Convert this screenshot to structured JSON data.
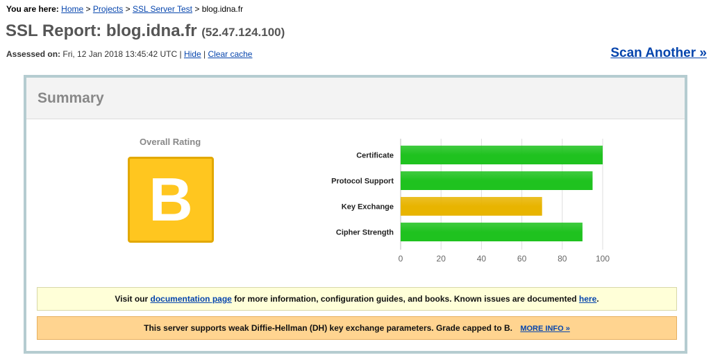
{
  "breadcrumb": {
    "prefix": "You are here:",
    "items": [
      "Home",
      "Projects",
      "SSL Server Test"
    ],
    "current": "blog.idna.fr"
  },
  "title": {
    "main": "SSL Report: blog.idna.fr",
    "ip": "(52.47.124.100)"
  },
  "assessed": {
    "label": "Assessed on:",
    "date": "Fri, 12 Jan 2018 13:45:42 UTC",
    "hide": "Hide",
    "clear_cache": "Clear cache"
  },
  "scan_another": "Scan Another »",
  "summary": {
    "heading": "Summary",
    "overall_label": "Overall Rating",
    "grade": "B"
  },
  "chart_data": {
    "type": "bar",
    "orientation": "horizontal",
    "categories": [
      "Certificate",
      "Protocol Support",
      "Key Exchange",
      "Cipher Strength"
    ],
    "values": [
      100,
      95,
      70,
      90
    ],
    "colors": [
      "#1fc21f",
      "#1fc21f",
      "#e8b400",
      "#1fc21f"
    ],
    "xlim": [
      0,
      100
    ],
    "ticks": [
      "0",
      "20",
      "40",
      "60",
      "80",
      "100"
    ],
    "grid": true
  },
  "notices": {
    "docs": {
      "text_a": "Visit our",
      "link_docs": "documentation page",
      "text_b": "for more information, configuration guides, and books. Known issues are documented",
      "link_here": "here",
      "text_c": "."
    },
    "dh": {
      "text": "This server supports weak Diffie-Hellman (DH) key exchange parameters. Grade capped to B.",
      "link": "MORE INFO »"
    }
  }
}
